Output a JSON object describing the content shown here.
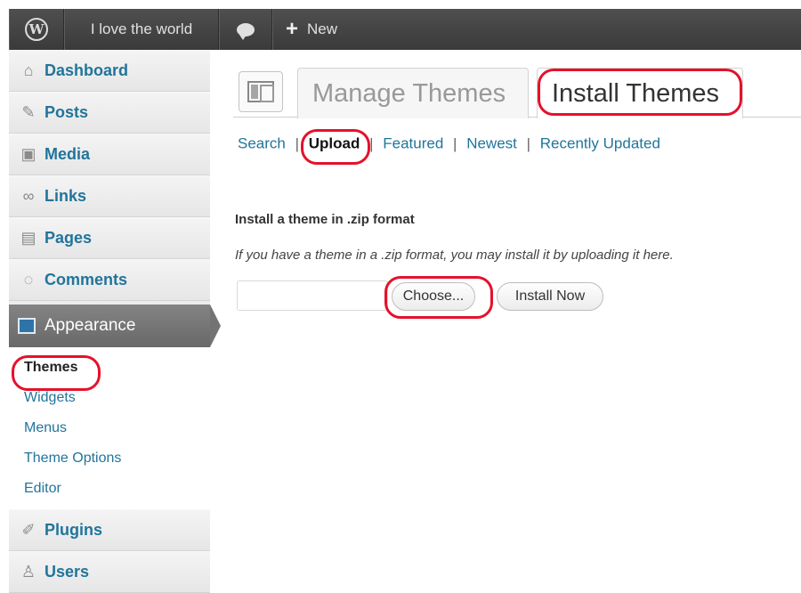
{
  "adminbar": {
    "logo_icon": "wordpress-logo-icon",
    "logo_glyph": "W",
    "site_name": "I love the world",
    "comments_icon": "comment-bubble-icon",
    "new_icon": "plus-icon",
    "new_glyph": "+",
    "new_label": "New"
  },
  "sidebar": {
    "items_top": [
      {
        "label": "Dashboard",
        "icon": "home-icon",
        "glyph": "⌂"
      },
      {
        "label": "Posts",
        "icon": "pushpin-icon",
        "glyph": "✎"
      },
      {
        "label": "Media",
        "icon": "media-icon",
        "glyph": "▣"
      },
      {
        "label": "Links",
        "icon": "chain-link-icon",
        "glyph": "∞"
      },
      {
        "label": "Pages",
        "icon": "pages-icon",
        "glyph": "▤"
      },
      {
        "label": "Comments",
        "icon": "comment-icon",
        "glyph": "◌"
      }
    ],
    "appearance": {
      "label": "Appearance",
      "icon": "appearance-icon"
    },
    "submenu": [
      "Themes",
      "Widgets",
      "Menus",
      "Theme Options",
      "Editor"
    ],
    "items_bottom": [
      {
        "label": "Plugins",
        "icon": "plug-icon",
        "glyph": "✐"
      },
      {
        "label": "Users",
        "icon": "users-icon",
        "glyph": "♙"
      }
    ]
  },
  "main": {
    "page_icon": "themes-page-icon",
    "tabs": [
      "Manage Themes",
      "Install Themes"
    ],
    "subnav": [
      "Search",
      "Upload",
      "Featured",
      "Newest",
      "Recently Updated"
    ],
    "separator": "|",
    "heading": "Install a theme in .zip format",
    "description": "If you have a theme in a .zip format, you may install it by uploading it here.",
    "choose_label": "Choose...",
    "install_label": "Install Now"
  },
  "colors": {
    "link": "#21759b",
    "annotation": "#e5112b",
    "adminbar": "#464646"
  }
}
